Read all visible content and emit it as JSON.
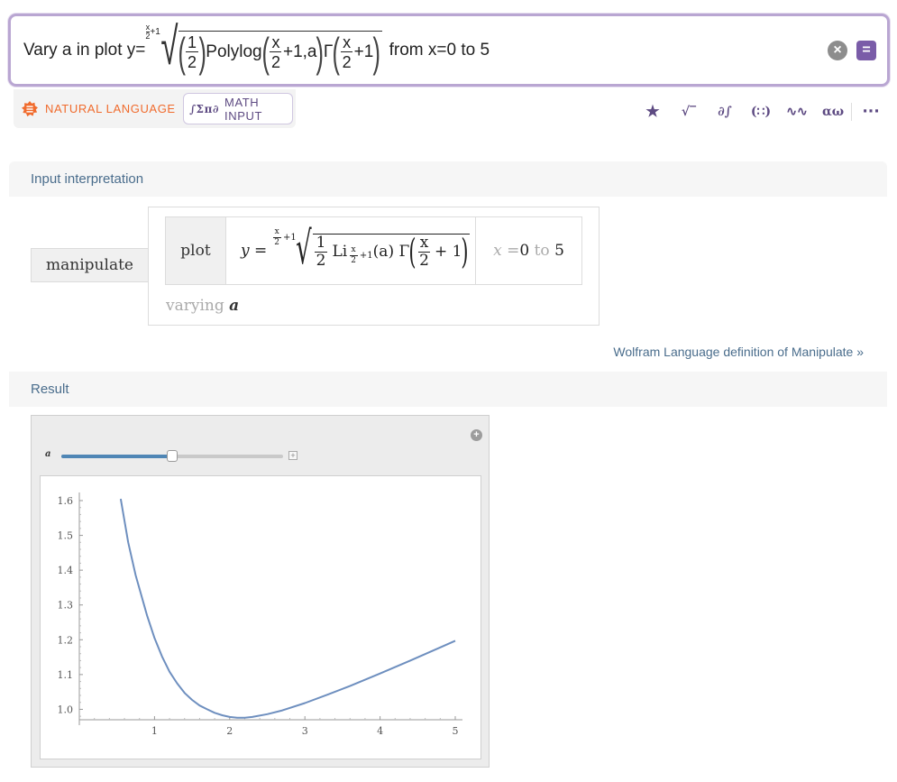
{
  "query": {
    "prefix": "Vary a in plot y=",
    "root_index_num": "x",
    "root_index_den": "2",
    "root_index_tail": "+1",
    "half_num": "1",
    "half_den": "2",
    "polylog": "Polylog",
    "pl_num": "x",
    "pl_den": "2",
    "pl_tail": "+1,a",
    "gamma": "Γ",
    "g_num": "x",
    "g_den": "2",
    "g_tail": "+1",
    "suffix": "from x=0 to 5",
    "clear_icon": "close-icon",
    "submit_icon": "equals-icon"
  },
  "modes": {
    "natural_language": "NATURAL LANGUAGE",
    "math_input": "MATH INPUT",
    "math_icon": "∫Σπ∂",
    "accent_orange": "#f06b2d",
    "accent_purple": "#5d4a82"
  },
  "toolbar": {
    "items": [
      {
        "name": "favorite-star-icon",
        "glyph": "★"
      },
      {
        "name": "sqrt-icon",
        "glyph": "√‾"
      },
      {
        "name": "calculus-icon",
        "glyph": "∂∫"
      },
      {
        "name": "matrix-icon",
        "glyph": "(∷)"
      },
      {
        "name": "waveform-icon",
        "glyph": "∿∿"
      },
      {
        "name": "greek-alpha-omega-icon",
        "glyph": "αω"
      }
    ],
    "more": "···"
  },
  "input_interpretation": {
    "title": "Input interpretation",
    "manipulate": "manipulate",
    "plot_label": "plot",
    "formula": {
      "lhs": "y =",
      "idx_num": "x",
      "idx_den": "2",
      "idx_tail": "+1",
      "half_num": "1",
      "half_den": "2",
      "li": "Li",
      "li_sub_num": "x",
      "li_sub_den": "2",
      "li_sub_tail": "+1",
      "li_arg": "(a) Γ",
      "g_num": "x",
      "g_den": "2",
      "g_tail": "+ 1"
    },
    "range": {
      "var": "x = ",
      "from": "0",
      "to_word": " to ",
      "to": "5"
    },
    "varying_word": "varying ",
    "varying_var": "a",
    "wl_link": "Wolfram Language definition of Manipulate »"
  },
  "result": {
    "title": "Result",
    "slider_label": "a",
    "slider_fraction": 0.5
  },
  "chart_data": {
    "type": "line",
    "title": "",
    "xlabel": "",
    "ylabel": "",
    "xlim": [
      0,
      5
    ],
    "ylim": [
      1.0,
      1.6
    ],
    "x_ticks": [
      "1",
      "2",
      "3",
      "4",
      "5"
    ],
    "y_ticks": [
      "1.0",
      "1.1",
      "1.2",
      "1.3",
      "1.4",
      "1.5",
      "1.6"
    ],
    "series": [
      {
        "color": "#6e8fbf",
        "x": [
          0.55,
          0.65,
          0.75,
          0.9,
          1.0,
          1.1,
          1.2,
          1.3,
          1.4,
          1.5,
          1.6,
          1.7,
          1.8,
          1.9,
          2.0,
          2.1,
          2.2,
          2.3,
          2.5,
          2.7,
          3.0,
          3.3,
          3.6,
          4.0,
          4.4,
          4.8,
          5.0
        ],
        "y": [
          1.605,
          1.48,
          1.385,
          1.27,
          1.205,
          1.152,
          1.108,
          1.075,
          1.047,
          1.027,
          1.011,
          1.0,
          0.99,
          0.983,
          0.978,
          0.976,
          0.976,
          0.978,
          0.986,
          0.997,
          1.018,
          1.042,
          1.067,
          1.103,
          1.14,
          1.178,
          1.197
        ]
      }
    ],
    "grid": false
  }
}
